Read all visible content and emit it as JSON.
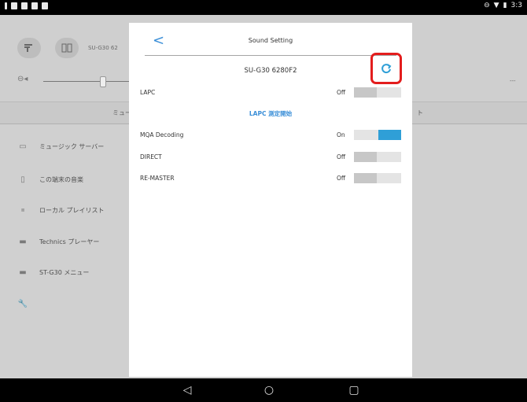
{
  "status_bar": {
    "time": "3:3"
  },
  "background_app": {
    "device_label": "SU-G30 62",
    "tab_left": "ミュー",
    "tab_right": "ト",
    "volume_right_text": "---",
    "menu": [
      {
        "icon": "server-icon",
        "label": "ミュージック サーバー"
      },
      {
        "icon": "tablet-icon",
        "label": "この端末の音楽"
      },
      {
        "icon": "local-playlist-icon",
        "label": "ローカル プレイリスト"
      },
      {
        "icon": "player-icon",
        "label": "Technics プレーヤー"
      },
      {
        "icon": "device-menu-icon",
        "label": "ST-G30 メニュー"
      },
      {
        "icon": "wrench-icon",
        "label": ""
      }
    ]
  },
  "dialog": {
    "back_label": "<",
    "title": "Sound Setting",
    "device_name": "SU-G30 6280F2",
    "rows": {
      "lapc": {
        "label": "LAPC",
        "state": "Off",
        "on": false
      },
      "lapc_measure": "LAPC 測定開始",
      "mqa": {
        "label": "MQA Decoding",
        "state": "On",
        "on": true
      },
      "direct": {
        "label": "DIRECT",
        "state": "Off",
        "on": false
      },
      "remaster": {
        "label": "RE-MASTER",
        "state": "Off",
        "on": false
      }
    }
  },
  "highlight_color": "#e31d1d",
  "accent_color": "#2f9fd7"
}
